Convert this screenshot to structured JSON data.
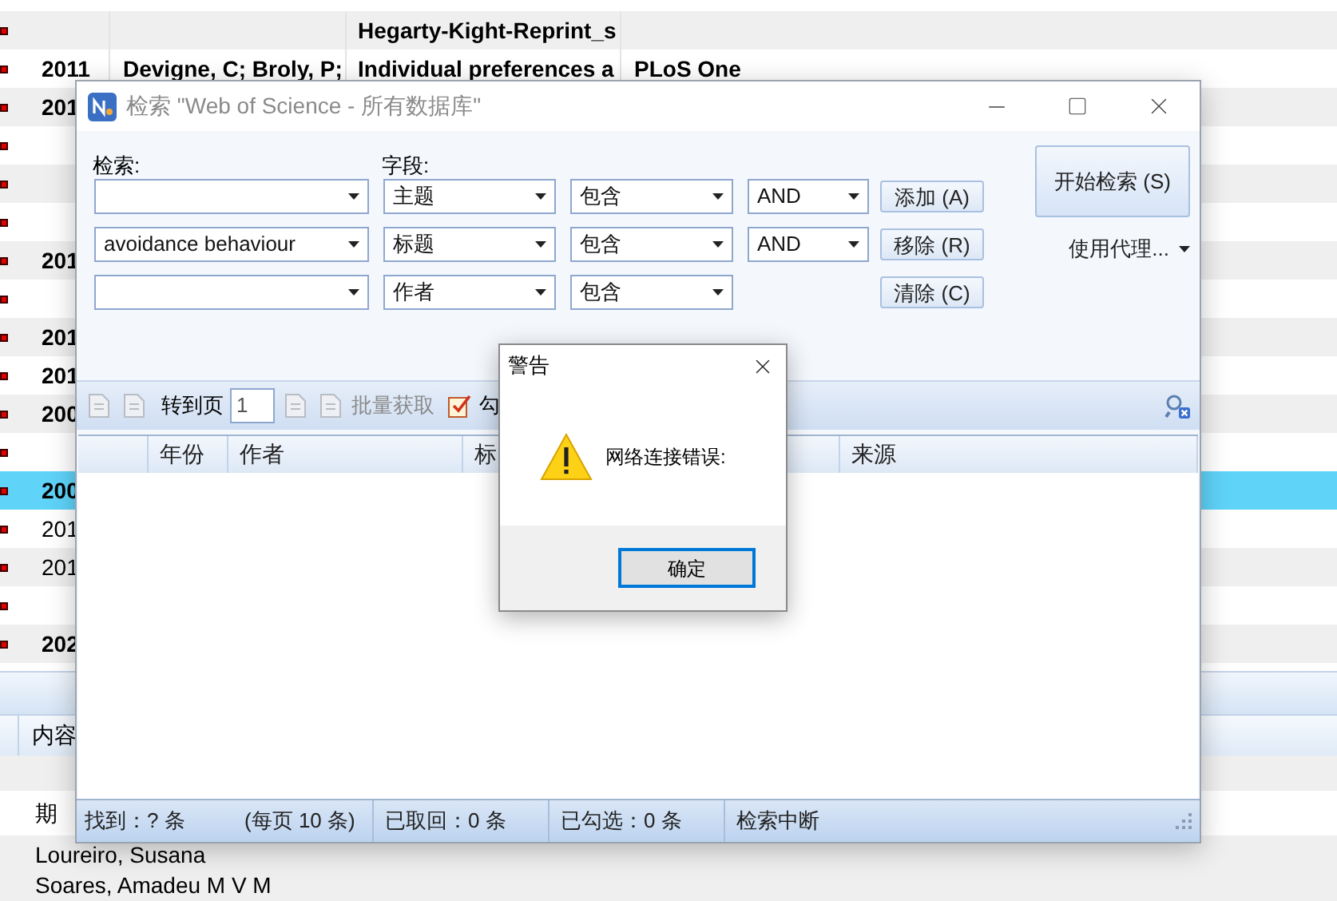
{
  "background_table": {
    "rows": [
      {
        "title": "Hegarty-Kight-Reprint_s",
        "bold": true,
        "selected": false,
        "marked": true
      },
      {
        "year": "2011",
        "author": "Devigne, C; Broly, P;",
        "title": "Individual preferences a",
        "source": "PLoS One",
        "bold": true,
        "selected": false,
        "marked": true
      },
      {
        "year": "201",
        "bold": true,
        "selected": false,
        "marked": true
      },
      {
        "bold": false,
        "selected": false,
        "marked": true
      },
      {
        "bold": false,
        "selected": false,
        "marked": true
      },
      {
        "bold": false,
        "selected": false,
        "marked": true
      },
      {
        "year": "201",
        "bold": true,
        "selected": false,
        "marked": true
      },
      {
        "bold": false,
        "selected": false,
        "marked": true
      },
      {
        "year": "201",
        "bold": true,
        "selected": false,
        "marked": true
      },
      {
        "year": "201",
        "bold": true,
        "selected": false,
        "marked": true
      },
      {
        "year": "200",
        "bold": true,
        "selected": false,
        "marked": true
      },
      {
        "bold": false,
        "selected": false,
        "marked": true
      },
      {
        "year": "200",
        "bold": true,
        "selected": true,
        "marked": true
      },
      {
        "year": "201",
        "bold": false,
        "selected": false,
        "marked": true
      },
      {
        "year": "201",
        "bold": false,
        "selected": false,
        "marked": true
      },
      {
        "bold": false,
        "selected": false,
        "marked": true
      },
      {
        "year": "202",
        "bold": true,
        "selected": false,
        "marked": true
      }
    ]
  },
  "bottom_pane": {
    "header": "内容",
    "field": "期",
    "authors": [
      "Loureiro, Susana",
      "Soares, Amadeu M V M"
    ]
  },
  "search_dialog": {
    "title": "检索 \"Web of Science - 所有数据库\"",
    "search_label": "检索:",
    "field_label": "字段:",
    "criteria": [
      {
        "field": "主题",
        "match": "包含",
        "operator": "AND"
      },
      {
        "query": "avoidance behaviour",
        "field": "标题",
        "match": "包含",
        "operator": "AND"
      },
      {
        "field": "作者",
        "match": "包含"
      }
    ],
    "buttons": [
      "添加 (A)",
      "移除 (R)",
      "清除 (C)"
    ],
    "search_button": "开始检索 (S)",
    "proxy_menu": "使用代理...",
    "toolbar": {
      "goto_label": "转到页",
      "page": "1",
      "fetch_label": "批量获取",
      "fetch_disabled": true,
      "check_label": "勾"
    },
    "columns": [
      {
        "label": "年份"
      },
      {
        "label": "作者"
      },
      {
        "label": "标"
      },
      {
        "label": "来源"
      }
    ],
    "status_bar": [
      "找到：? 条",
      "(每页 10 条)",
      "已取回：0 条",
      "已勾选：0 条",
      "检索中断"
    ]
  },
  "alert": {
    "title": "警告",
    "message": "网络连接错误:",
    "ok": "确定"
  }
}
